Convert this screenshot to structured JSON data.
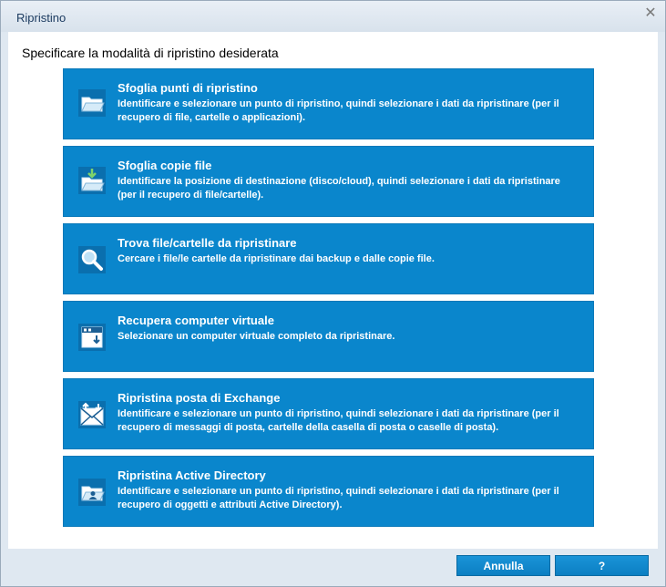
{
  "dialog": {
    "title": "Ripristino",
    "heading": "Specificare la modalità di ripristino desiderata"
  },
  "options": [
    {
      "title": "Sfoglia punti di ripristino",
      "description": "Identificare e selezionare un punto di ripristino, quindi selezionare i dati da ripristinare (per il recupero di file, cartelle o applicazioni).",
      "icon": "folder-open-icon"
    },
    {
      "title": "Sfoglia copie file",
      "description": "Identificare la posizione di destinazione (disco/cloud), quindi selezionare i dati da ripristinare (per il recupero di file/cartelle).",
      "icon": "folder-download-icon"
    },
    {
      "title": "Trova file/cartelle da ripristinare",
      "description": "Cercare i file/le cartelle da ripristinare dai backup e dalle copie file.",
      "icon": "magnifier-icon"
    },
    {
      "title": "Recupera computer virtuale",
      "description": "Selezionare un computer virtuale completo da ripristinare.",
      "icon": "virtual-machine-icon"
    },
    {
      "title": "Ripristina posta di Exchange",
      "description": "Identificare e selezionare un punto di ripristino, quindi selezionare i dati da ripristinare (per il recupero di messaggi di posta, cartelle della casella di posta o caselle di posta).",
      "icon": "exchange-mail-icon"
    },
    {
      "title": "Ripristina Active Directory",
      "description": "Identificare e selezionare un punto di ripristino, quindi selezionare i dati da ripristinare (per il recupero di oggetti e attributi Active Directory).",
      "icon": "active-directory-icon"
    }
  ],
  "footer": {
    "cancel_label": "Annulla",
    "help_label": "?"
  }
}
